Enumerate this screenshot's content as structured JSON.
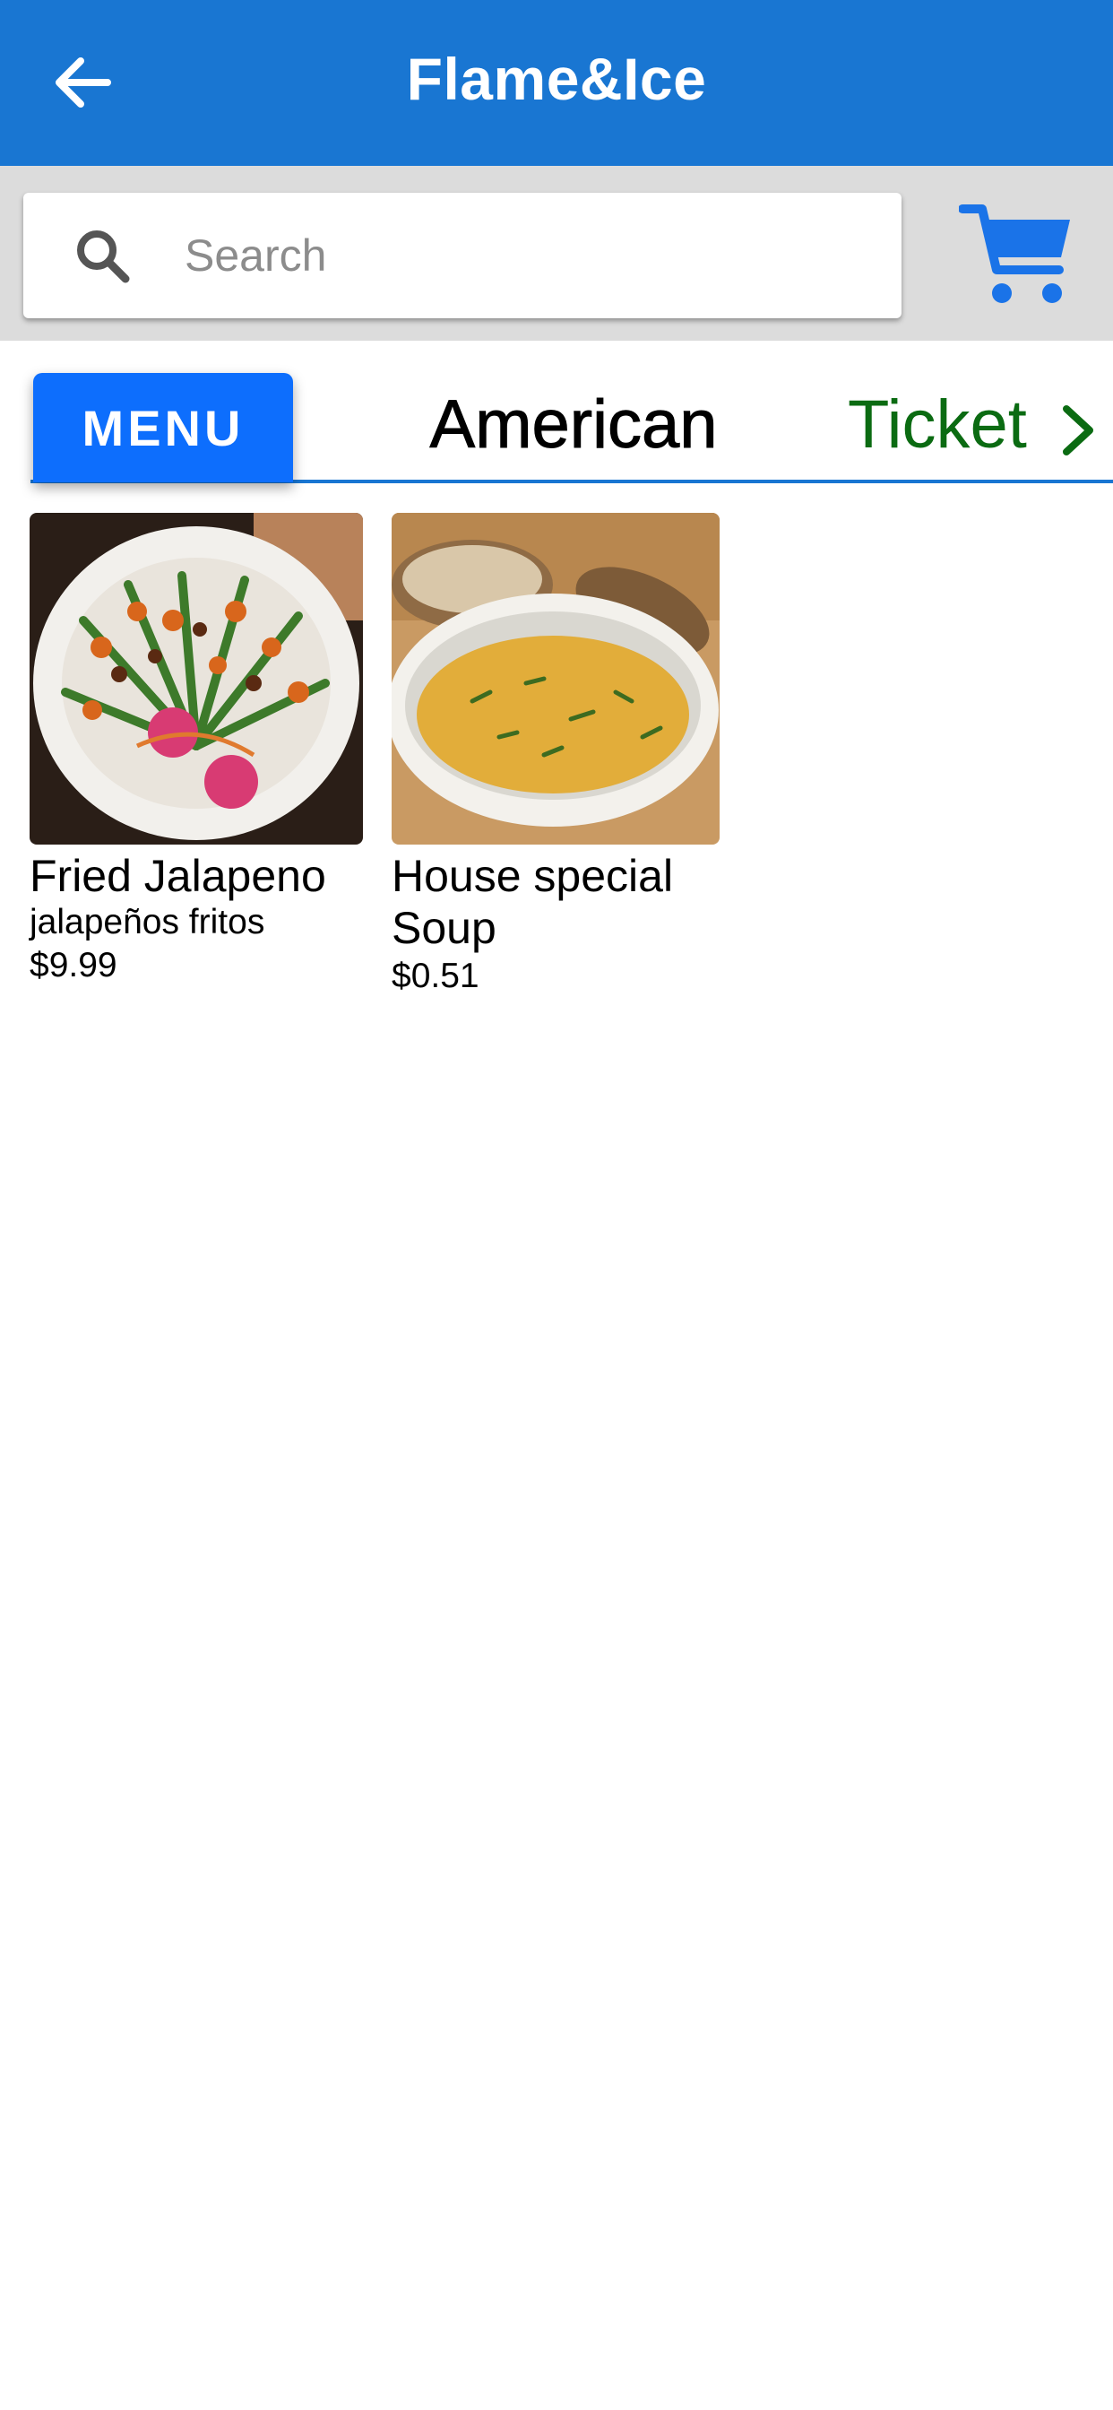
{
  "header": {
    "title": "Flame&Ice",
    "back_icon": "arrow-left-icon",
    "background": "#1976d2"
  },
  "search": {
    "placeholder": "Search",
    "value": "",
    "icon": "search-icon"
  },
  "cart": {
    "icon": "cart-icon",
    "color": "#1a73e8"
  },
  "tabs": [
    {
      "label": "MENU",
      "active": true,
      "color": "#0d6efd"
    },
    {
      "label": "American",
      "active": false
    },
    {
      "label": "Ticket",
      "active": false,
      "color": "#0b6b12"
    }
  ],
  "products": [
    {
      "name": "Fried Jalapeno",
      "description": "jalapeños fritos",
      "price": "$9.99",
      "image": "fried-jalapeno-photo"
    },
    {
      "name": "House special Soup",
      "description": "",
      "price": "$0.51",
      "image": "house-soup-photo"
    }
  ]
}
